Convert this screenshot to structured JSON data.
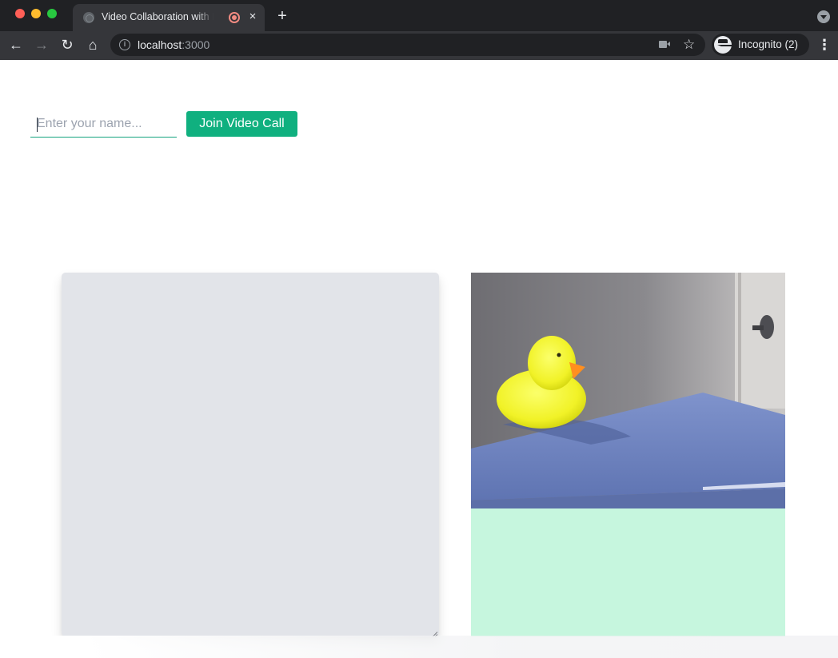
{
  "browser": {
    "tab": {
      "title": "Video Collaboration with Nexmo",
      "close_glyph": "×"
    },
    "new_tab_glyph": "+",
    "nav": {
      "back_glyph": "←",
      "forward_glyph": "→",
      "reload_glyph": "↻",
      "home_glyph": "⌂"
    },
    "address": {
      "host": "localhost",
      "port": ":3000"
    },
    "star_glyph": "☆",
    "profile_label": "Incognito (2)",
    "menu_glyph": "⋮"
  },
  "page": {
    "name_input": {
      "value": "",
      "placeholder": "Enter your name..."
    },
    "join_button_label": "Join Video Call"
  },
  "icons": {
    "tab_favicon": "globe-icon",
    "tab_indicator": "recording-icon",
    "info": "info-icon",
    "camera": "camera-icon",
    "bookmark": "star-icon",
    "profile": "incognito-icon"
  },
  "colors": {
    "accent": "#10b07f",
    "input_underline": "#14a37f",
    "notes_background": "#e2e4e9",
    "video_panel_background": "#c6f6de",
    "recording_indicator": "#f28b82"
  }
}
